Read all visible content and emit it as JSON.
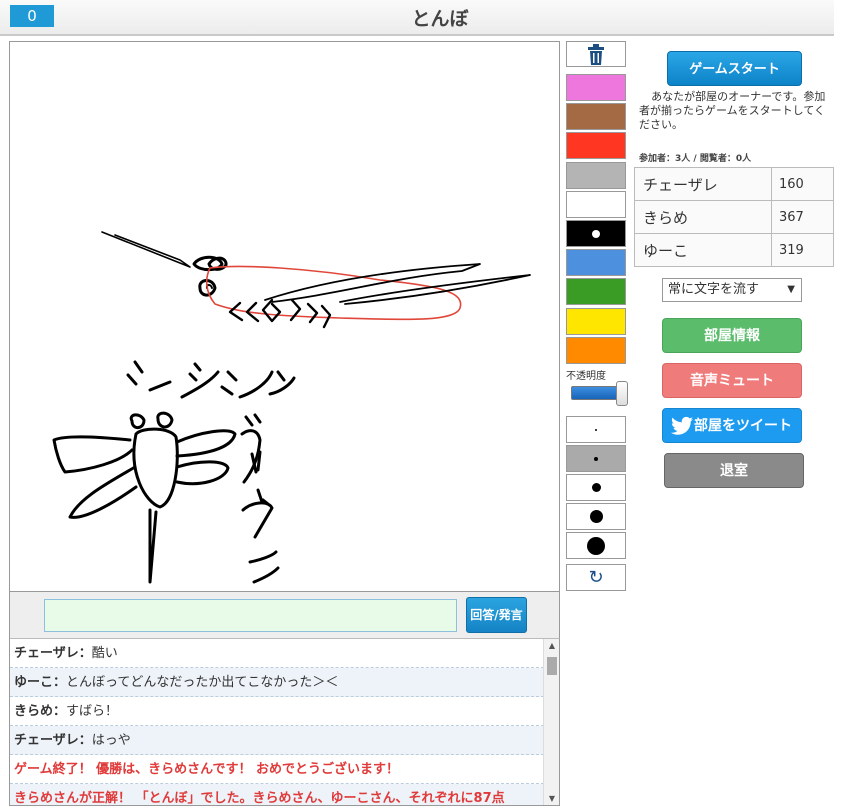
{
  "header": {
    "score": "0",
    "word": "とんぼ"
  },
  "answer": {
    "input_value": "",
    "button_label": "回答/発言"
  },
  "chat": [
    {
      "name": "チェーザレ：",
      "msg": "酷い",
      "system": false
    },
    {
      "name": "ゆーこ：",
      "msg": "とんぼってどんなだったか出てこなかった＞＜",
      "system": false
    },
    {
      "name": "きらめ：",
      "msg": "すばら！",
      "system": false
    },
    {
      "name": "チェーザレ：",
      "msg": "はっや",
      "system": false
    },
    {
      "name": "",
      "msg": "ゲーム終了！ 優勝は、きらめさんです！ おめでとうございます！",
      "system": true
    },
    {
      "name": "",
      "msg": "きらめさんが正解！ 「とんぼ」でした。きらめさん、ゆーこさん、それぞれに87点",
      "system": true
    }
  ],
  "tools": {
    "colors": [
      "#ee77dd",
      "#a36a43",
      "#ff3622",
      "#b4b4b4",
      "#ffffff",
      "#000000",
      "#4d90dd",
      "#3a9c25",
      "#ffe600",
      "#ff8a00"
    ],
    "selected_color_index": 5,
    "opacity_label": "不透明度",
    "opacity_value": 1.0,
    "brush_sizes": [
      2,
      4,
      9,
      13,
      18
    ],
    "active_size_index": 1
  },
  "panel": {
    "start_label": "ゲームスタート",
    "owner_msg": "あなたが部屋のオーナーです。参加者が揃ったらゲームをスタートしてください。",
    "counts": "参加者：3人 / 閲覧者：0人",
    "players": [
      {
        "name": "チェーザレ",
        "points": "160"
      },
      {
        "name": "きらめ",
        "points": "367"
      },
      {
        "name": "ゆーこ",
        "points": "319"
      }
    ],
    "mode_select": "常に文字を流す",
    "room_info_label": "部屋情報",
    "mute_label": "音声ミュート",
    "tweet_label": "部屋をツイート",
    "exit_label": "退室"
  }
}
